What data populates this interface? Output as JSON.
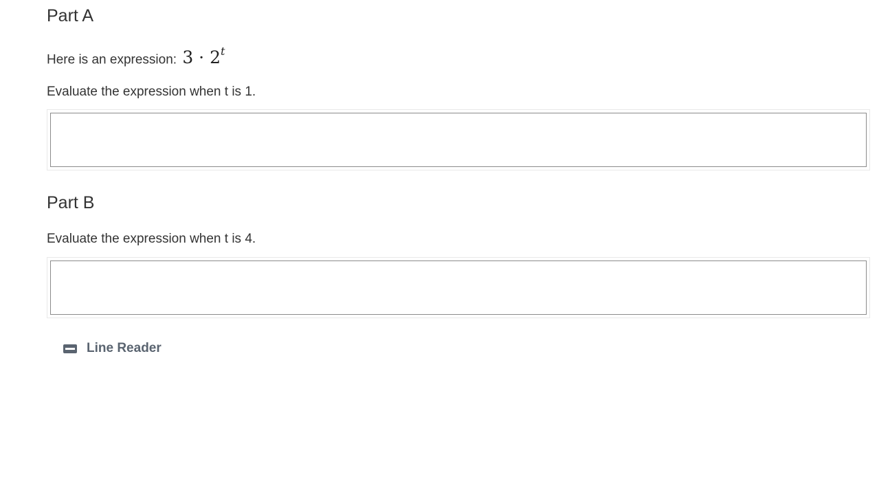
{
  "part_a": {
    "heading": "Part A",
    "intro_text": "Here is an expression: ",
    "expression_base": "3 · 2",
    "expression_exponent": "t",
    "question": "Evaluate the expression when t is 1.",
    "answer_value": ""
  },
  "part_b": {
    "heading": "Part B",
    "question": "Evaluate the expression when t is 4.",
    "answer_value": ""
  },
  "tools": {
    "line_reader_label": "Line Reader",
    "line_reader_icon": "line-reader-icon"
  }
}
